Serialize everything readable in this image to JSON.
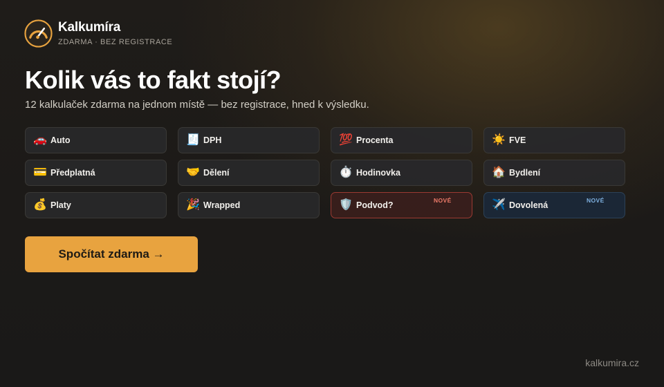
{
  "brand": {
    "name": "Kalkumíra",
    "tagline": "ZDARMA · BEZ REGISTRACE",
    "logo_icon": "gauge-icon"
  },
  "hero": {
    "title": "Kolik vás to fakt stojí?",
    "subtitle": "12 kalkulaček zdarma na jednom místě — bez registrace, hned k výsledku."
  },
  "calculators": [
    {
      "label": "Auto",
      "icon": "🚗",
      "icon_name": "car-icon"
    },
    {
      "label": "DPH",
      "icon": "🧾",
      "icon_name": "receipt-icon"
    },
    {
      "label": "Procenta",
      "icon": "💯",
      "icon_name": "hundred-points-icon"
    },
    {
      "label": "FVE",
      "icon": "☀️",
      "icon_name": "sun-icon"
    },
    {
      "label": "Předplatná",
      "icon": "💳",
      "icon_name": "credit-card-icon"
    },
    {
      "label": "Dělení",
      "icon": "🤝",
      "icon_name": "handshake-icon"
    },
    {
      "label": "Hodinovka",
      "icon": "⏱️",
      "icon_name": "stopwatch-icon"
    },
    {
      "label": "Bydlení",
      "icon": "🏠",
      "icon_name": "house-icon"
    },
    {
      "label": "Platy",
      "icon": "💰",
      "icon_name": "money-bag-icon"
    },
    {
      "label": "Wrapped",
      "icon": "🎉",
      "icon_name": "party-popper-icon"
    },
    {
      "label": "Podvod?",
      "icon": "🛡️",
      "icon_name": "shield-icon",
      "badge": "NOVÉ",
      "variant": "alert"
    },
    {
      "label": "Dovolená",
      "icon": "✈️",
      "icon_name": "airplane-icon",
      "badge": "NOVÉ",
      "variant": "info"
    }
  ],
  "cta": {
    "label": "Spočítat zdarma →"
  },
  "footer": {
    "domain": "kalkumira.cz"
  },
  "colors": {
    "accent": "#e8a33f",
    "background": "#1c1a18",
    "alert": "#9c3a32",
    "info": "#2c4258"
  }
}
